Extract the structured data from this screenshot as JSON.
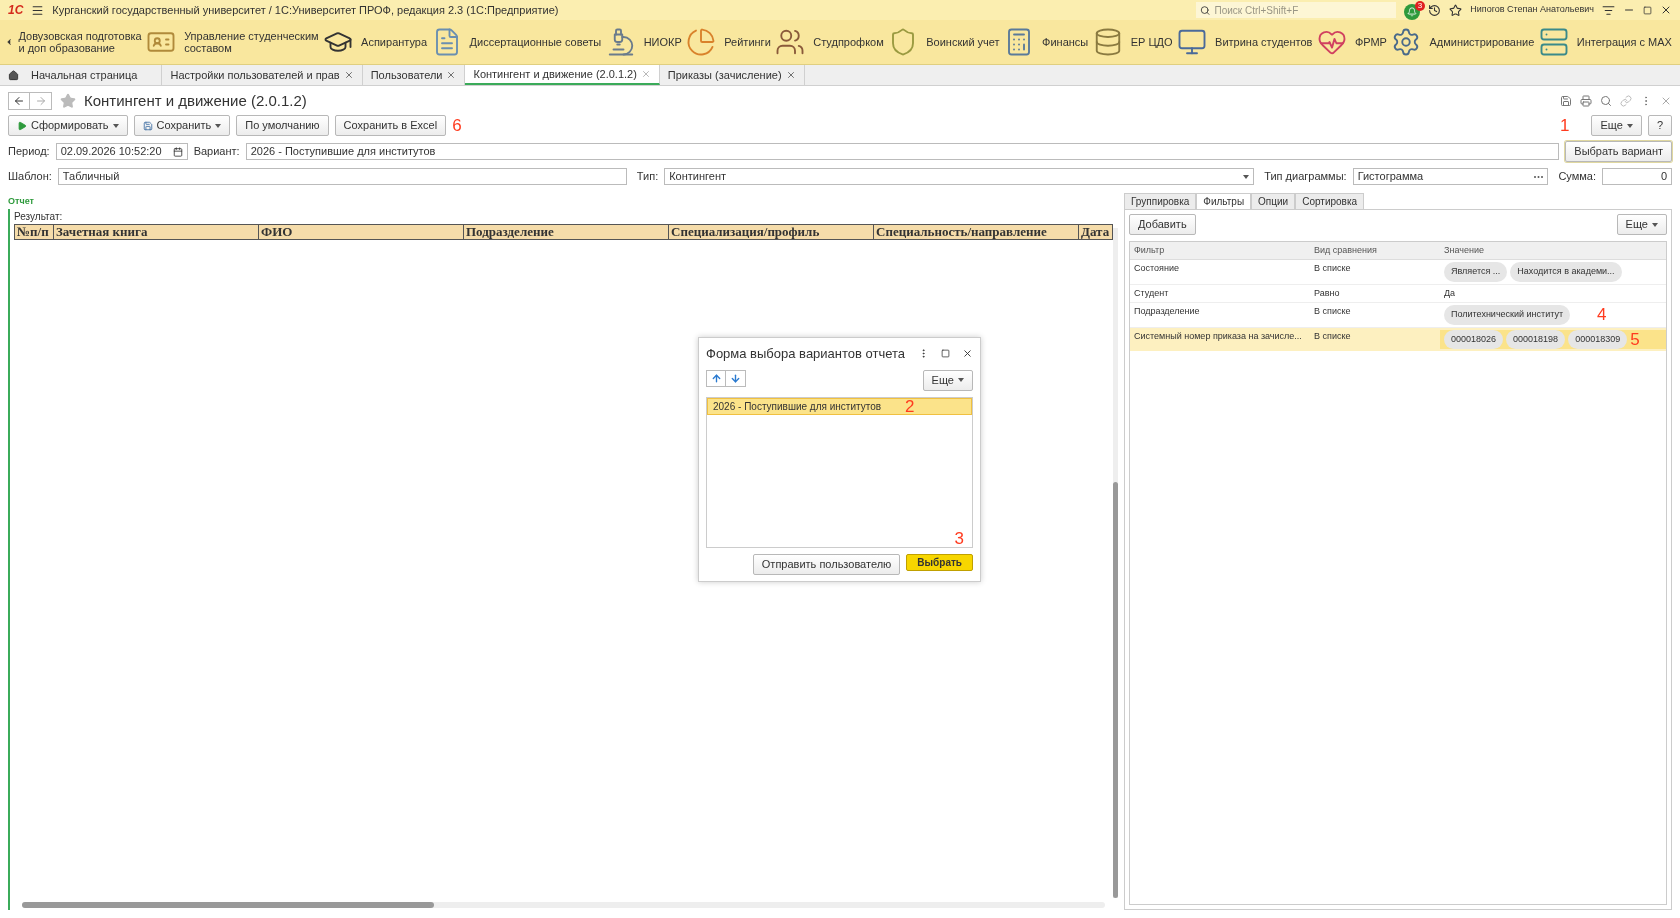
{
  "window": {
    "title": "Курганский государственный университет / 1С:Университет ПРОФ, редакция 2.3  (1С:Предприятие)",
    "logo": "1С",
    "search_placeholder": "Поиск Ctrl+Shift+F",
    "notifications": "3",
    "user": "Нипогов Степан Анатольевич"
  },
  "sections": [
    {
      "label": "Довузовская подготовка\nи доп образование"
    },
    {
      "label": "Управление студенческим\nсоставом"
    },
    {
      "label": "Аспирантура"
    },
    {
      "label": "Диссертационные советы"
    },
    {
      "label": "НИОКР"
    },
    {
      "label": "Рейтинги"
    },
    {
      "label": "Студпрофком"
    },
    {
      "label": "Воинский учет"
    },
    {
      "label": "Финансы"
    },
    {
      "label": "ЕР ЦДО"
    },
    {
      "label": "Витрина студентов"
    },
    {
      "label": "ФРМР"
    },
    {
      "label": "Администрирование"
    },
    {
      "label": "Интеграция с МАХ"
    }
  ],
  "tabs": [
    {
      "label": "Начальная страница",
      "kind": "home",
      "selected": false
    },
    {
      "label": "Настройки пользователей и прав",
      "kind": "doc",
      "selected": false
    },
    {
      "label": "Пользователи",
      "kind": "doc",
      "selected": false
    },
    {
      "label": "Контингент и движение (2.0.1.2)",
      "kind": "doc",
      "selected": true
    },
    {
      "label": "Приказы (зачисление)",
      "kind": "doc",
      "selected": false
    }
  ],
  "form": {
    "title": "Контингент и движение (2.0.1.2)",
    "toolbar": [
      {
        "label": "Сформировать",
        "kind": "run"
      },
      {
        "label": "Сохранить",
        "kind": "save"
      },
      {
        "label": "По умолчанию",
        "kind": "plain"
      },
      {
        "label": "Сохранить в Excel",
        "kind": "plain"
      }
    ],
    "more": "Еще",
    "help": "?",
    "choose_variant": "Выбрать вариант",
    "period_label": "Период:",
    "period": "02.09.2026 10:52:20",
    "variant_label": "Вариант:",
    "variant": "2026 - Поступившие для институтов",
    "template_label": "Шаблон:",
    "template": "Табличный",
    "type_label": "Тип:",
    "type": "Контингент",
    "chart_type_label": "Тип диаграммы:",
    "chart_type": "Гистограмма",
    "sum_label": "Сумма:",
    "sum": "0",
    "report_label": "Отчет",
    "result_label": "Результат:",
    "columns": [
      "№п/п",
      "Зачетная книга",
      "ФИО",
      "Подразделение",
      "Специализация/профиль",
      "Специальность/направление",
      "Дата"
    ]
  },
  "settings": {
    "tabs": [
      {
        "label": "Группировка",
        "selected": false
      },
      {
        "label": "Фильтры",
        "selected": true
      },
      {
        "label": "Опции",
        "selected": false
      },
      {
        "label": "Сортировка",
        "selected": false
      }
    ],
    "add": "Добавить",
    "more": "Еще",
    "columns": [
      "Фильтр",
      "Вид сравнения",
      "Значение"
    ],
    "rows": [
      {
        "filter": "Состояние",
        "comparison": "В списке",
        "kind": "chips",
        "values": [
          "Является ...",
          "Находится в академи..."
        ],
        "selected": false
      },
      {
        "filter": "Студент",
        "comparison": "Равно",
        "kind": "text",
        "values": [
          "Да"
        ],
        "selected": false
      },
      {
        "filter": "Подразделение",
        "comparison": "В списке",
        "kind": "chips",
        "values": [
          "Политехнический институт"
        ],
        "selected": false
      },
      {
        "filter": "Системный номер приказа на зачисле...",
        "comparison": "В списке",
        "kind": "chips",
        "values": [
          "000018026",
          "000018198",
          "000018309"
        ],
        "selected": true
      }
    ]
  },
  "dialog": {
    "title": "Форма выбора вариантов отчета",
    "more": "Еще",
    "items": [
      {
        "label": "2026 - Поступившие для институтов",
        "selected": true
      }
    ],
    "send": "Отправить пользователю",
    "choose": "Выбрать"
  },
  "annotations": [
    "1",
    "2",
    "3",
    "4",
    "5",
    "6"
  ]
}
